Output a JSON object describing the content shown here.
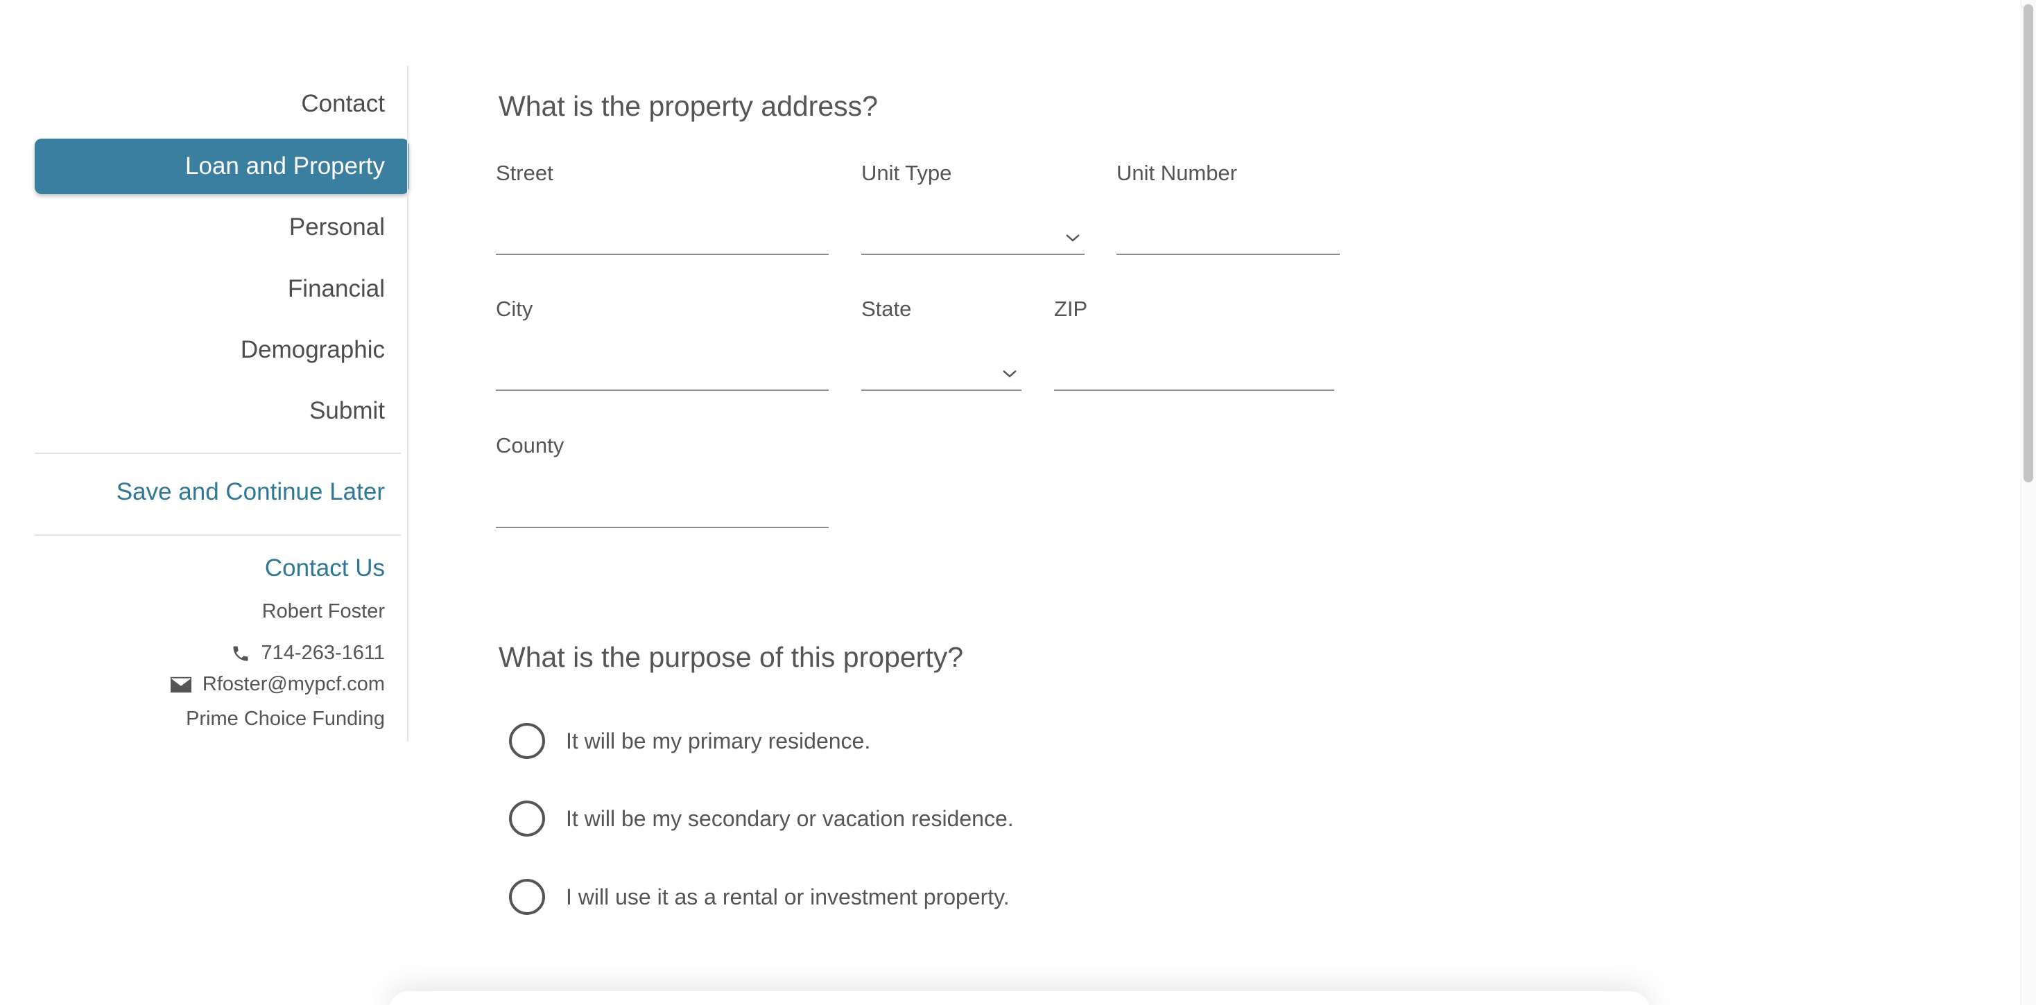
{
  "sidebar": {
    "nav": [
      {
        "label": "Contact",
        "active": false
      },
      {
        "label": "Loan and Property",
        "active": true
      },
      {
        "label": "Personal",
        "active": false
      },
      {
        "label": "Financial",
        "active": false
      },
      {
        "label": "Demographic",
        "active": false
      },
      {
        "label": "Submit",
        "active": false
      }
    ],
    "save_link": "Save and Continue Later",
    "contact_us": "Contact Us",
    "agent_name": "Robert Foster",
    "phone": "714-263-1611",
    "email": "Rfoster@mypcf.com",
    "company": "Prime Choice Funding",
    "icons": {
      "phone": "phone-icon",
      "email": "envelope-icon"
    },
    "accent_color": "#3a7fa0"
  },
  "address_section": {
    "title": "What is the property address?",
    "fields": {
      "street": {
        "label": "Street",
        "value": ""
      },
      "unit_type": {
        "label": "Unit Type",
        "value": ""
      },
      "unit_number": {
        "label": "Unit Number",
        "value": ""
      },
      "city": {
        "label": "City",
        "value": ""
      },
      "state": {
        "label": "State",
        "value": ""
      },
      "zip": {
        "label": "ZIP",
        "value": ""
      },
      "county": {
        "label": "County",
        "value": ""
      }
    }
  },
  "purpose_section": {
    "title": "What is the purpose of this property?",
    "options": [
      {
        "label": "It will be my primary residence.",
        "selected": false
      },
      {
        "label": "It will be my secondary or vacation residence.",
        "selected": false
      },
      {
        "label": "I will use it as a rental or investment property.",
        "selected": false
      }
    ]
  }
}
